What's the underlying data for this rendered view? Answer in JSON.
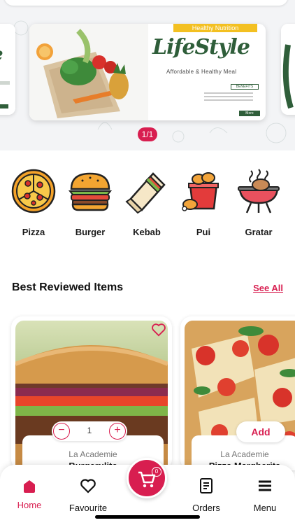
{
  "banner": {
    "ribbon_text": "Healthy Nutrition",
    "brand": "LifeStyle",
    "tagline": "Affordable & Healthy Meal",
    "benefits_label": "BENEFITS",
    "more_label": "More",
    "pager": "1/1"
  },
  "categories": [
    {
      "label": "Pizza",
      "icon": "pizza-icon"
    },
    {
      "label": "Burger",
      "icon": "burger-icon"
    },
    {
      "label": "Kebab",
      "icon": "kebab-icon"
    },
    {
      "label": "Pui",
      "icon": "chicken-icon"
    },
    {
      "label": "Gratar",
      "icon": "grill-icon"
    }
  ],
  "section": {
    "title": "Best Reviewed Items",
    "see_all": "See All"
  },
  "items": [
    {
      "restaurant": "La Academie",
      "name": "Burgerulite",
      "quantity": "1"
    },
    {
      "restaurant": "La Academie",
      "name": "Pizza Margherita",
      "add_label": "Add"
    }
  ],
  "nav": {
    "home": "Home",
    "favourite": "Favourite",
    "orders": "Orders",
    "menu": "Menu",
    "cart_count": "0"
  },
  "colors": {
    "accent": "#d81e50",
    "brand_green": "#2f5e3a"
  }
}
